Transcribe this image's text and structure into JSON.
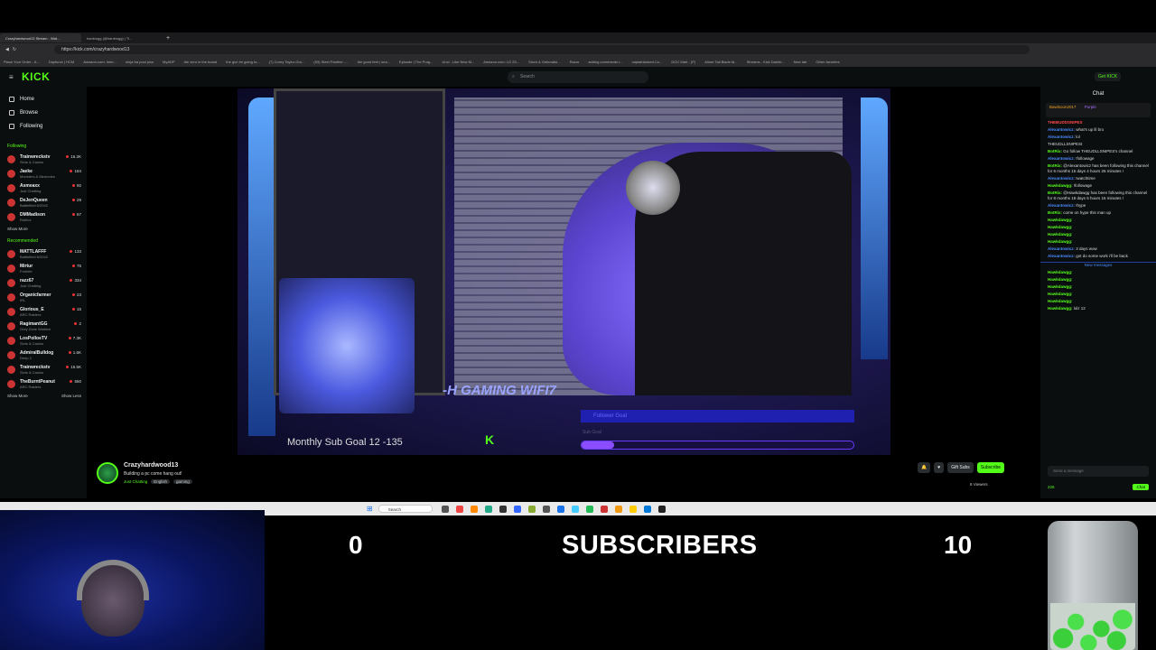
{
  "browser": {
    "tabs": [
      "Crazyhardwood13 Stream - Wat...",
      "hardvsgg (@hardvsgg) | Ti..."
    ],
    "url": "https://kick.com/crazyhardwood13",
    "bookmarks": [
      "Place Your Order - A...",
      "Dayforce | HCM",
      "Amazon.com: Inter...",
      "ninja tra pool pics",
      "MyADP",
      "the zero in the board",
      "the gun im going to...",
      "(7) Corey Taylor-Gro...",
      "(93) Steel Panther -...",
      "the good feet | sea...",
      "Episode | The Purg...",
      "Uncl - Like New M...",
      "Amazon.com: LG 25...",
      "Sincir & Gekuraful...",
      "Razor",
      "adding commands t...",
      "captainkicked.Co...",
      "DOC Mart - (P)",
      "Allure Tail Blade Al...",
      "Streams - Kick Dashb...",
      "New tab"
    ],
    "other_favorites": "Other favorites"
  },
  "header": {
    "logo": "KICK",
    "search_placeholder": "Search",
    "get_kick": "Get KICK"
  },
  "sidebar": {
    "nav": [
      {
        "label": "Home",
        "icon": "home-icon"
      },
      {
        "label": "Browse",
        "icon": "compass-icon"
      },
      {
        "label": "Following",
        "icon": "heart-icon"
      }
    ],
    "following_title": "Following",
    "following": [
      {
        "name": "Trainwreckstv",
        "game": "Slots & Casino",
        "viewers": "16.2K"
      },
      {
        "name": "Jaeke",
        "game": "Monsters & Memories",
        "viewers": "184"
      },
      {
        "name": "Asmeaxx",
        "game": "Just Chatting",
        "viewers": "92"
      },
      {
        "name": "DeJenQueen",
        "game": "Battlefield 6/2042",
        "viewers": "29"
      },
      {
        "name": "DMMadison",
        "game": "Roblox",
        "viewers": "67"
      }
    ],
    "show_more": "Show More",
    "recommended_title": "Recommended",
    "recommended": [
      {
        "name": "MATTLAFFF",
        "game": "Battlefield 6/2042",
        "viewers": "133"
      },
      {
        "name": "Mirtur",
        "game": "Fortnite",
        "viewers": "75"
      },
      {
        "name": "razz67",
        "game": "Just Chatting",
        "viewers": "334"
      },
      {
        "name": "Organicfarmer",
        "game": "IRL",
        "viewers": "23"
      },
      {
        "name": "Glorious_E",
        "game": "ARC Raiders",
        "viewers": "15"
      },
      {
        "name": "RagimantGG",
        "game": "Grey Zone Warfare",
        "viewers": "2"
      },
      {
        "name": "LosPolloeTV",
        "game": "Slots & Casino",
        "viewers": "7.3K"
      },
      {
        "name": "AdmiralBulldog",
        "game": "Deep 2",
        "viewers": "1.6K"
      },
      {
        "name": "Trainwreckstv",
        "game": "Slots & Casino",
        "viewers": "16.5K"
      },
      {
        "name": "TheBurntPeanut",
        "game": "ARC Raiders",
        "viewers": "550"
      }
    ],
    "show_less": "Show Less"
  },
  "video": {
    "sub_goal_text": "Monthly Sub Goal  12  -135",
    "follower_goal": "Follower Goal",
    "sub_goal_label": "Sub Goal",
    "motherboard_text": "-H GAMING WIFI7",
    "sub_progress": 0.12
  },
  "streamer": {
    "name": "Crazyhardwood13",
    "title": "Building a pc come hang out!",
    "category": "Just Chatting",
    "tags": [
      "English",
      "gaming"
    ],
    "viewers": "8 Viewers",
    "gift_subs": "Gift Subs",
    "subscribe": "Subscribe"
  },
  "chat": {
    "title": "Chat",
    "pinned_user": "Bawlsoon2017",
    "pinned_sub": "Purple",
    "messages": [
      {
        "user": "THEBUDDSNIPES",
        "text": "",
        "color": "r"
      },
      {
        "user": "Alexantowicz:",
        "text": "what's up lil bro",
        "color": "b"
      },
      {
        "user": "Alexantowicz:",
        "text": "lol",
        "color": "b"
      },
      {
        "user": "",
        "text": "THEUDLLSNIPESt",
        "color": "g"
      },
      {
        "user": "BotRix:",
        "text": "Go follow THEUDLLSNIPES's channel",
        "color": "g"
      },
      {
        "user": "Alexantowicz:",
        "text": "!followage",
        "color": "b"
      },
      {
        "user": "BotRix:",
        "text": "@Alexantowicz has been following this channel for 6 months 15 days 4 hours 26 minutes !",
        "color": "g"
      },
      {
        "user": "Alexantowicz:",
        "text": "!watchtime",
        "color": "b"
      },
      {
        "user": "Hawkdawgg:",
        "text": "!followage",
        "color": "g"
      },
      {
        "user": "BotRix:",
        "text": "@Hawkdawgg has been following this channel for 8 months 18 days 5 hours 16 minutes !",
        "color": "g"
      },
      {
        "user": "Alexantowicz:",
        "text": "!hype",
        "color": "b"
      },
      {
        "user": "BotRix:",
        "text": "come on hype this man up",
        "color": "g"
      },
      {
        "user": "Hawkdawgg:",
        "text": "",
        "color": "g"
      },
      {
        "user": "Hawkdawgg:",
        "text": "",
        "color": "g"
      },
      {
        "user": "Hawkdawgg:",
        "text": "",
        "color": "g"
      },
      {
        "user": "Hawkdawgg:",
        "text": "",
        "color": "g"
      },
      {
        "user": "Alexantowicz:",
        "text": "3 days wow",
        "color": "b"
      },
      {
        "user": "Alexantowicz:",
        "text": "got do some work i'll be back",
        "color": "b"
      }
    ],
    "new_messages": "New messages",
    "new": [
      {
        "user": "Hawkdawgg:",
        "text": ""
      },
      {
        "user": "Hawkdawgg:",
        "text": ""
      },
      {
        "user": "Hawkdawgg:",
        "text": ""
      },
      {
        "user": "Hawkdawgg:",
        "text": ""
      },
      {
        "user": "Hawkdawgg:",
        "text": ""
      },
      {
        "user": "Hawkdawgg:",
        "text": "lolz 12"
      }
    ],
    "input_placeholder": "Send a message",
    "points": "226",
    "chat_button": "Chat"
  },
  "taskbar": {
    "search": "Search"
  },
  "overlay": {
    "left_count": "0",
    "label": "SUBSCRIBERS",
    "right_count": "10"
  }
}
